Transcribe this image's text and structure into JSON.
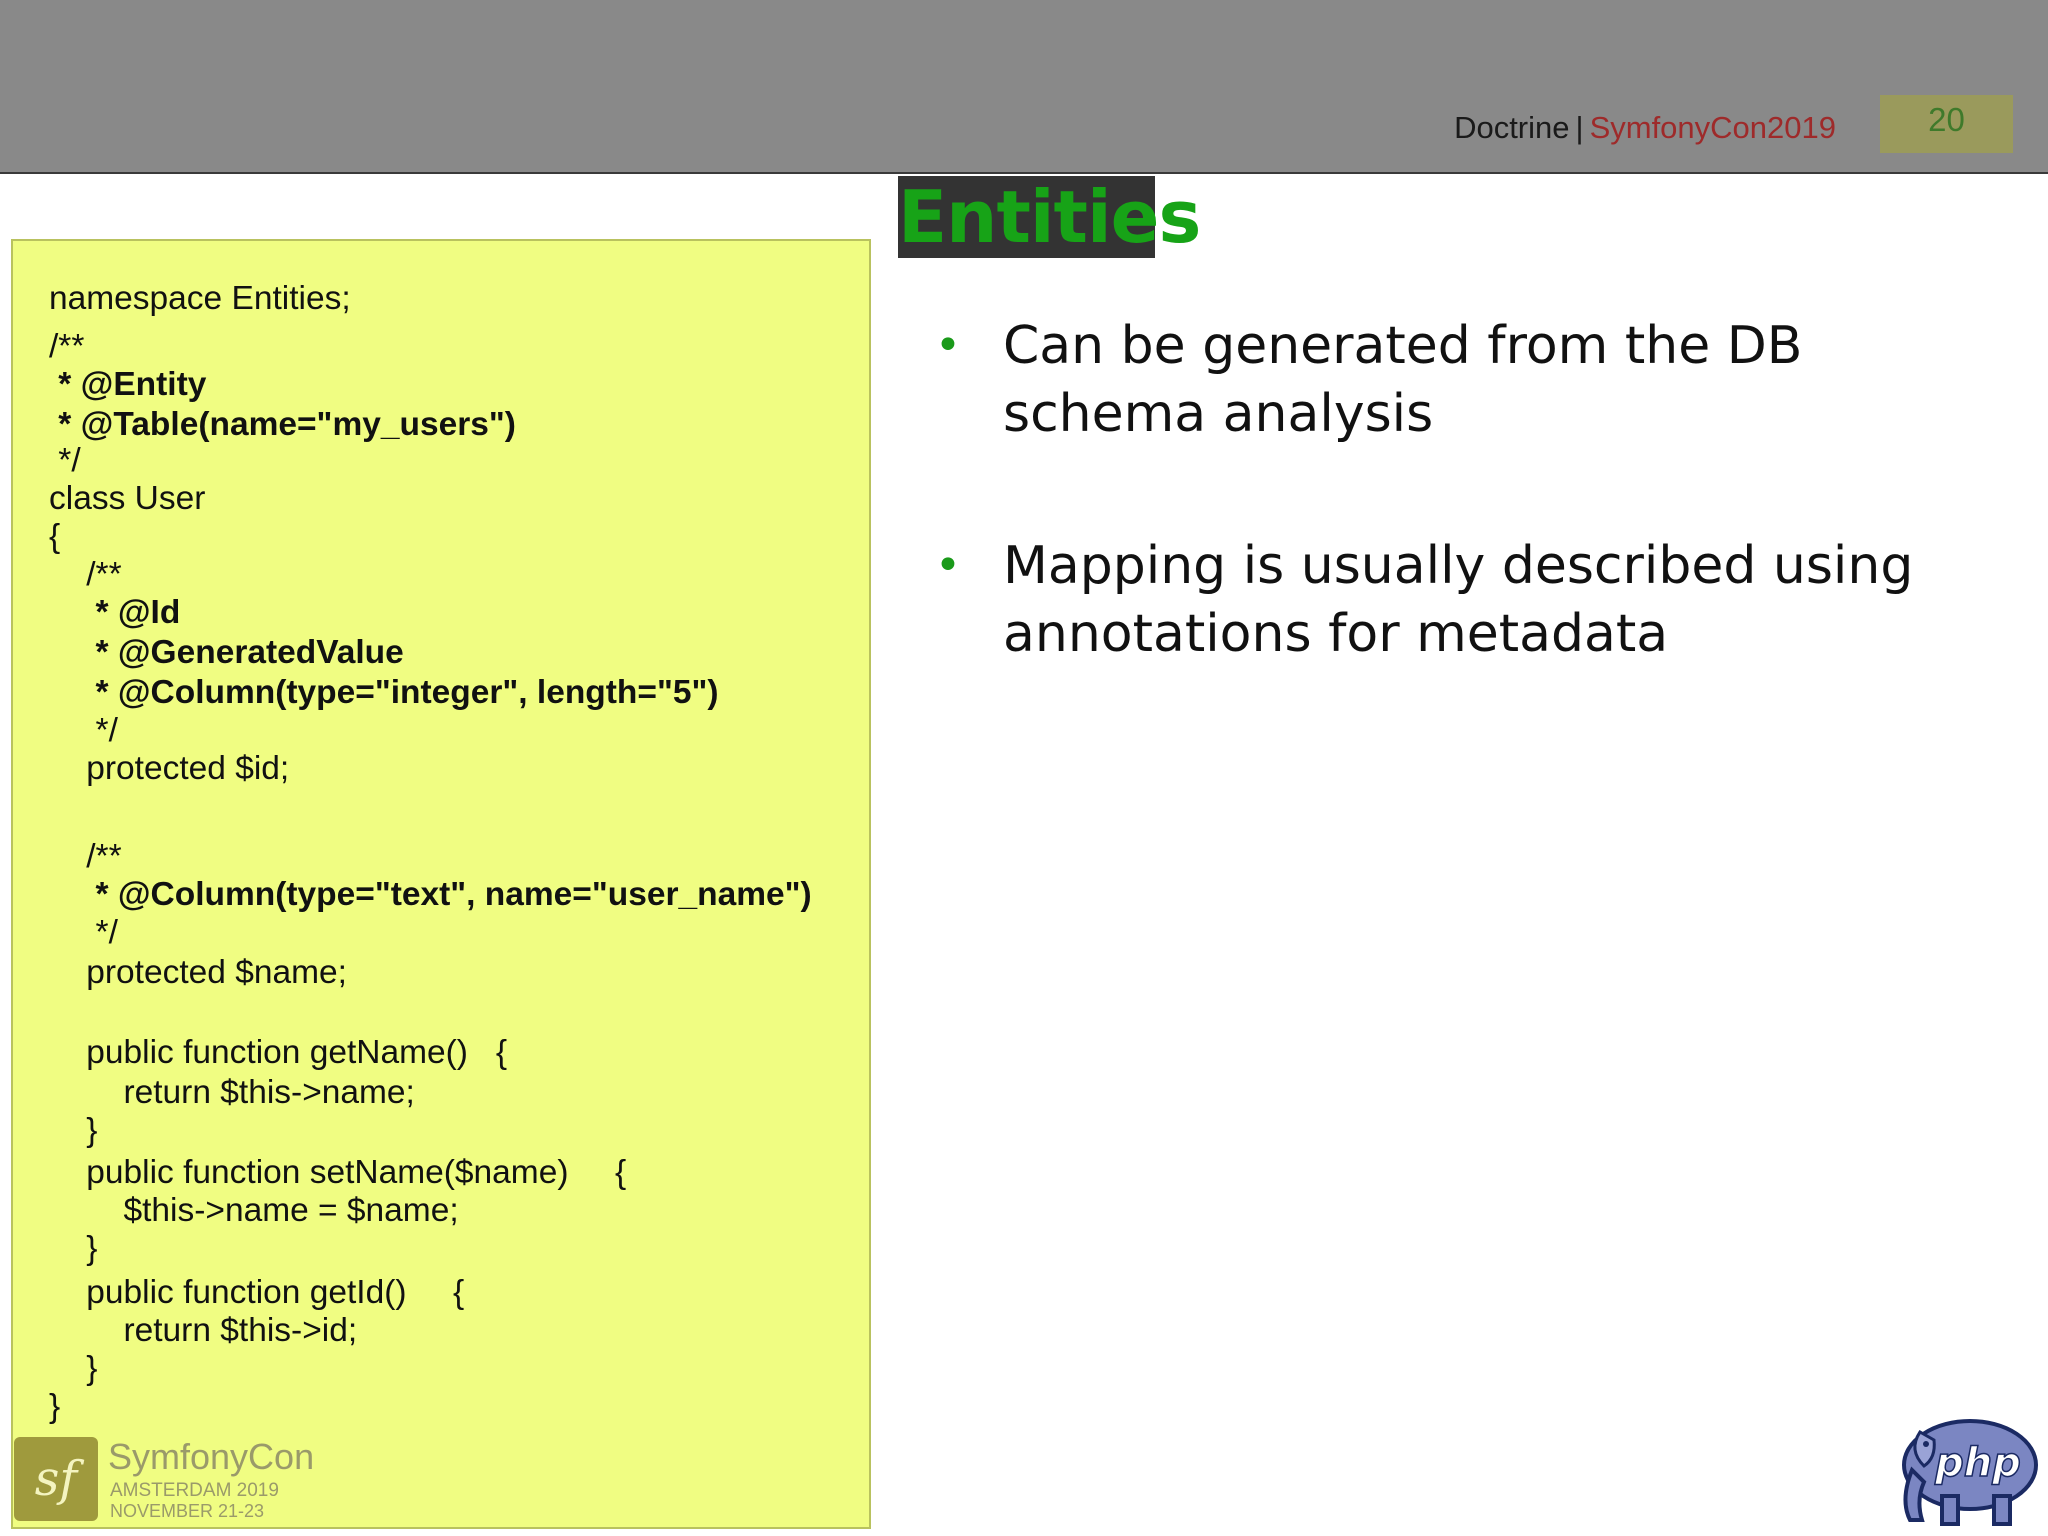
{
  "header": {
    "doc_title": "Doctrine",
    "separator": "|",
    "conference": "SymfonyCon2019",
    "page_number": "20"
  },
  "slide": {
    "title": "Entities",
    "code_lines": [
      {
        "text": "namespace Entities;",
        "bold": false
      },
      {
        "text": "/**",
        "bold": false
      },
      {
        "text": " * @Entity",
        "bold": true
      },
      {
        "text": " * @Table(name=\"my_users\")",
        "bold": true
      },
      {
        "text": " */",
        "bold": false
      },
      {
        "text": "class User",
        "bold": false
      },
      {
        "text": "{",
        "bold": false
      },
      {
        "text": "    /**",
        "bold": false
      },
      {
        "text": "     * @Id",
        "bold": true
      },
      {
        "text": "     * @GeneratedValue",
        "bold": true
      },
      {
        "text": "     * @Column(type=\"integer\", length=\"5\")",
        "bold": true
      },
      {
        "text": "     */",
        "bold": false
      },
      {
        "text": "    protected $id;",
        "bold": false
      },
      {
        "text": "    /**",
        "bold": false
      },
      {
        "text": "     * @Column(type=\"text\", name=\"user_name\")",
        "bold": true
      },
      {
        "text": "     */",
        "bold": false
      },
      {
        "text": "    protected $name;",
        "bold": false
      },
      {
        "text": "    public function getName()   {",
        "bold": false
      },
      {
        "text": "        return $this->name;",
        "bold": false
      },
      {
        "text": "    }",
        "bold": false
      },
      {
        "text": "    public function setName($name)     {",
        "bold": false
      },
      {
        "text": "        $this->name = $name;",
        "bold": false
      },
      {
        "text": "    }",
        "bold": false
      },
      {
        "text": "    public function getId()     {",
        "bold": false
      },
      {
        "text": "        return $this->id;",
        "bold": false
      },
      {
        "text": "    }",
        "bold": false
      },
      {
        "text": "}",
        "bold": false
      }
    ],
    "bullets": [
      {
        "marker": "•",
        "text": "Can be generated from the DB schema analysis"
      },
      {
        "marker": "•",
        "text": "Mapping is usually described using annotations for metadata"
      }
    ]
  },
  "logos": {
    "symfonycon": {
      "mark": "sf",
      "name": "SymfonyCon",
      "place": "AMSTERDAM 2019",
      "date": "NOVEMBER 21-23"
    },
    "php": {
      "text": "php",
      "icon": "php-elephant-icon"
    }
  },
  "colors": {
    "header_bg": "#898989",
    "conference_text": "#9e2a2a",
    "page_badge_bg": "#9a9a5c",
    "title_bg": "#333333",
    "title_text": "#17a317",
    "code_bg": "#f0fd82",
    "bullet_marker": "#1a9a1a"
  }
}
